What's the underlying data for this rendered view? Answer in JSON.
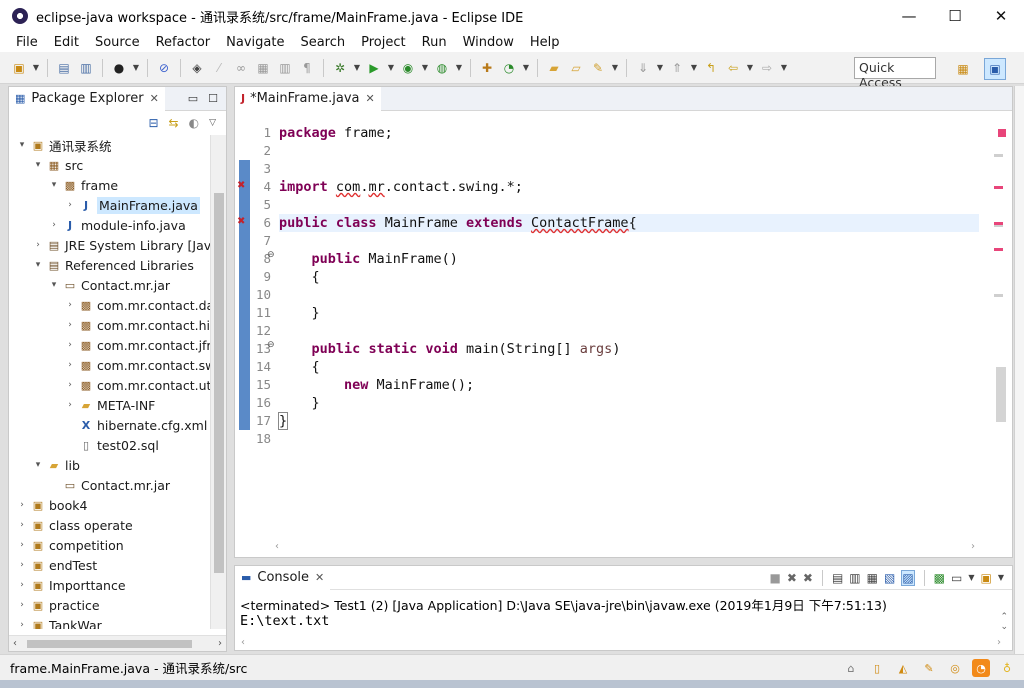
{
  "window": {
    "title": "eclipse-java workspace - 通讯录系统/src/frame/MainFrame.java - Eclipse IDE",
    "minimize": "—",
    "maximize": "☐",
    "close": "✕"
  },
  "menu": [
    "File",
    "Edit",
    "Source",
    "Refactor",
    "Navigate",
    "Search",
    "Project",
    "Run",
    "Window",
    "Help"
  ],
  "toolbar": {
    "quick_access": "Quick Access"
  },
  "explorer": {
    "tab_label": "Package Explorer",
    "tab_close": "✕",
    "tree": [
      {
        "label": "通讯录系统",
        "depth": 0,
        "twisty": "▾",
        "icon": "project-icon",
        "glyph": "▣"
      },
      {
        "label": "src",
        "depth": 1,
        "twisty": "▾",
        "icon": "source-folder-icon",
        "glyph": "▦"
      },
      {
        "label": "frame",
        "depth": 2,
        "twisty": "▾",
        "icon": "package-icon",
        "glyph": "▩"
      },
      {
        "label": "MainFrame.java",
        "depth": 3,
        "twisty": "›",
        "icon": "java-file-icon",
        "glyph": "J",
        "selected": true
      },
      {
        "label": "module-info.java",
        "depth": 2,
        "twisty": "›",
        "icon": "java-file-icon",
        "glyph": "J"
      },
      {
        "label": "JRE System Library [Java",
        "depth": 1,
        "twisty": "›",
        "icon": "library-icon",
        "glyph": "▤"
      },
      {
        "label": "Referenced Libraries",
        "depth": 1,
        "twisty": "▾",
        "icon": "library-icon",
        "glyph": "▤"
      },
      {
        "label": "Contact.mr.jar",
        "depth": 2,
        "twisty": "▾",
        "icon": "jar-icon",
        "glyph": "▭"
      },
      {
        "label": "com.mr.contact.da",
        "depth": 3,
        "twisty": "›",
        "icon": "package-icon",
        "glyph": "▩"
      },
      {
        "label": "com.mr.contact.hib",
        "depth": 3,
        "twisty": "›",
        "icon": "package-icon",
        "glyph": "▩"
      },
      {
        "label": "com.mr.contact.jfre",
        "depth": 3,
        "twisty": "›",
        "icon": "package-icon",
        "glyph": "▩"
      },
      {
        "label": "com.mr.contact.sw",
        "depth": 3,
        "twisty": "›",
        "icon": "package-icon",
        "glyph": "▩"
      },
      {
        "label": "com.mr.contact.util",
        "depth": 3,
        "twisty": "›",
        "icon": "package-icon",
        "glyph": "▩"
      },
      {
        "label": "META-INF",
        "depth": 3,
        "twisty": "›",
        "icon": "folder-icon",
        "glyph": "▰"
      },
      {
        "label": "hibernate.cfg.xml",
        "depth": 3,
        "twisty": "",
        "icon": "xml-file-icon",
        "glyph": "X"
      },
      {
        "label": "test02.sql",
        "depth": 3,
        "twisty": "",
        "icon": "file-icon",
        "glyph": "▯"
      },
      {
        "label": "lib",
        "depth": 1,
        "twisty": "▾",
        "icon": "folder-icon",
        "glyph": "▰"
      },
      {
        "label": "Contact.mr.jar",
        "depth": 2,
        "twisty": "",
        "icon": "jar-icon",
        "glyph": "▭"
      },
      {
        "label": "book4",
        "depth": 0,
        "twisty": "›",
        "icon": "project-icon",
        "glyph": "▣"
      },
      {
        "label": "class operate",
        "depth": 0,
        "twisty": "›",
        "icon": "project-icon",
        "glyph": "▣"
      },
      {
        "label": "competition",
        "depth": 0,
        "twisty": "›",
        "icon": "project-icon",
        "glyph": "▣"
      },
      {
        "label": "endTest",
        "depth": 0,
        "twisty": "›",
        "icon": "project-icon",
        "glyph": "▣"
      },
      {
        "label": "Importtance",
        "depth": 0,
        "twisty": "›",
        "icon": "project-icon",
        "glyph": "▣"
      },
      {
        "label": "practice",
        "depth": 0,
        "twisty": "›",
        "icon": "project-icon",
        "glyph": "▣"
      },
      {
        "label": "TankWar",
        "depth": 0,
        "twisty": "›",
        "icon": "project-icon",
        "glyph": "▣"
      }
    ]
  },
  "editor": {
    "tab_label": "*MainFrame.java",
    "tab_close": "✕",
    "line_numbers": [
      "1",
      "2",
      "3",
      "4",
      "5",
      "6",
      "7",
      "8",
      "9",
      "10",
      "11",
      "12",
      "13",
      "14",
      "15",
      "16",
      "17",
      "18"
    ],
    "code": {
      "l1_kw": "package",
      "l1_rest": " frame;",
      "l4_kw": "import",
      "l4_pkg_a": "com",
      "l4_dot": ".",
      "l4_pkg_b": "mr",
      "l4_rest": ".contact.swing.*;",
      "l6_kw1": "public",
      "l6_sp1": " ",
      "l6_kw2": "class",
      "l6_name": " MainFrame ",
      "l6_kw3": "extends",
      "l6_sp2": " ",
      "l6_super": "ContactFrame",
      "l6_brace": "{",
      "l8_indent": "    ",
      "l8_kw": "public",
      "l8_rest": " MainFrame()",
      "l9": "    {",
      "l11": "    }",
      "l13_indent": "    ",
      "l13_kw1": "public",
      "l13_sp1": " ",
      "l13_kw2": "static",
      "l13_sp2": " ",
      "l13_kw3": "void",
      "l13_rest": " main(String[] ",
      "l13_arg": "args",
      "l13_close": ")",
      "l14": "    {",
      "l15_indent": "        ",
      "l15_kw": "new",
      "l15_rest": " MainFrame();",
      "l16": "    }",
      "l17": "}"
    }
  },
  "console": {
    "tab_label": "Console",
    "tab_close": "✕",
    "status": "<terminated> Test1 (2) [Java Application] D:\\Java SE\\java-jre\\bin\\javaw.exe (2019年1月9日 下午7:51:13)",
    "output": "E:\\text.txt"
  },
  "statusbar": {
    "text": "frame.MainFrame.java - 通讯录系统/src"
  },
  "colors": {
    "keyword": "#7f0055",
    "error": "#e8457a",
    "selection": "#cde8ff",
    "current_line": "#e8f2fe"
  }
}
